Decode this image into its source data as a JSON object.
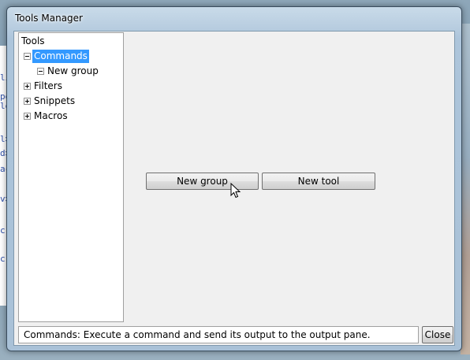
{
  "window": {
    "title": "Tools Manager"
  },
  "background": {
    "fragments": [
      "lit",
      "per",
      "le",
      "l>",
      "d>",
      "ac",
      "v>",
      "c",
      "c"
    ]
  },
  "tree": {
    "root_label": "Tools",
    "items": [
      {
        "label": "Commands",
        "state": "expanded",
        "selected": true
      },
      {
        "label": "New group",
        "state": "expanded",
        "selected": false
      },
      {
        "label": "Filters",
        "state": "collapsed",
        "selected": false
      },
      {
        "label": "Snippets",
        "state": "collapsed",
        "selected": false
      },
      {
        "label": "Macros",
        "state": "collapsed",
        "selected": false
      }
    ]
  },
  "actions": {
    "new_group_label": "New group",
    "new_tool_label": "New tool"
  },
  "status_bar": {
    "text": "Commands: Execute a command and send its output to the output pane.",
    "close_label": "Close"
  },
  "colors": {
    "selection": "#3399ff",
    "client_bg": "#f0f0f0",
    "frame": "#adc5db"
  }
}
